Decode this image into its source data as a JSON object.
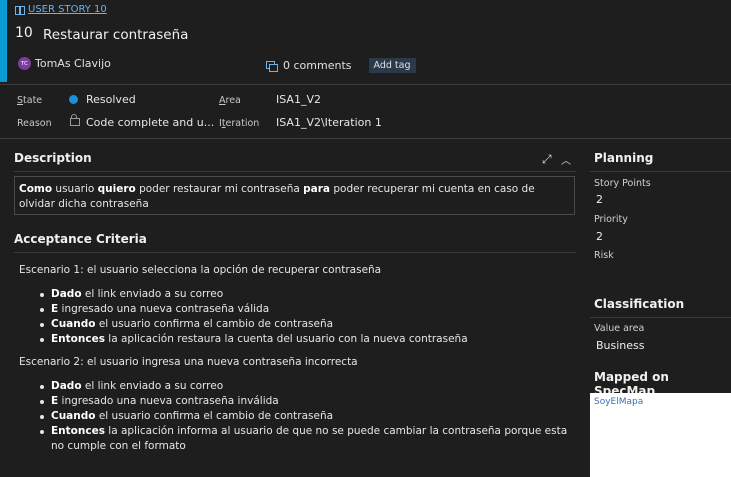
{
  "colors": {
    "accent": "#0a9bd6",
    "state_resolved": "#1f8ed8",
    "link": "#6cb2eb"
  },
  "header": {
    "type_link": "USER STORY 10",
    "id": "10",
    "title": "Restaurar contraseña",
    "avatar_initials": "TC",
    "owner": "TomAs Clavijo",
    "comments": "0 comments",
    "add_tag": "Add tag"
  },
  "fields": {
    "state_label": "State",
    "state_value": "Resolved",
    "area_label": "Area",
    "area_value": "ISA1_V2",
    "reason_label": "Reason",
    "reason_value": "Code complete and u...",
    "iteration_label": "Iteration",
    "iteration_value": "ISA1_V2\\Iteration 1"
  },
  "description": {
    "heading": "Description",
    "t1": "Como",
    "t2": " usuario ",
    "t3": "quiero",
    "t4": " poder restaurar mi contraseña ",
    "t5": "para",
    "t6": " poder recuperar mi cuenta en caso de olvidar dicha contraseña"
  },
  "acceptance": {
    "heading": "Acceptance Criteria",
    "scenario1": "Escenario 1: el usuario selecciona la opción de recuperar contraseña",
    "s1": [
      {
        "kw": "Dado",
        "text": " el link enviado a su correo"
      },
      {
        "kw": "E",
        "text": " ingresado una nueva contraseña válida"
      },
      {
        "kw": "Cuando",
        "text": " el usuario confirma el cambio de contraseña"
      },
      {
        "kw": "Entonces",
        "text": " la aplicación restaura la cuenta del usuario con la nueva contraseña"
      }
    ],
    "scenario2": "Escenario 2: el usuario ingresa una nueva contraseña incorrecta",
    "s2": [
      {
        "kw": "Dado",
        "text": " el link enviado a su correo"
      },
      {
        "kw": "E",
        "text": " ingresado una nueva contraseña inválida"
      },
      {
        "kw": "Cuando",
        "text": " el usuario confirma el cambio de contraseña"
      },
      {
        "kw": "Entonces",
        "text": " la aplicación informa al usuario de que no se puede cambiar la contraseña porque esta no cumple con el formato"
      }
    ]
  },
  "planning": {
    "heading": "Planning",
    "story_points_label": "Story Points",
    "story_points": "2",
    "priority_label": "Priority",
    "priority": "2",
    "risk_label": "Risk"
  },
  "classification": {
    "heading": "Classification",
    "value_area_label": "Value area",
    "value_area": "Business"
  },
  "specmap": {
    "heading": "Mapped on SpecMap",
    "link": "SoyElMapa"
  }
}
